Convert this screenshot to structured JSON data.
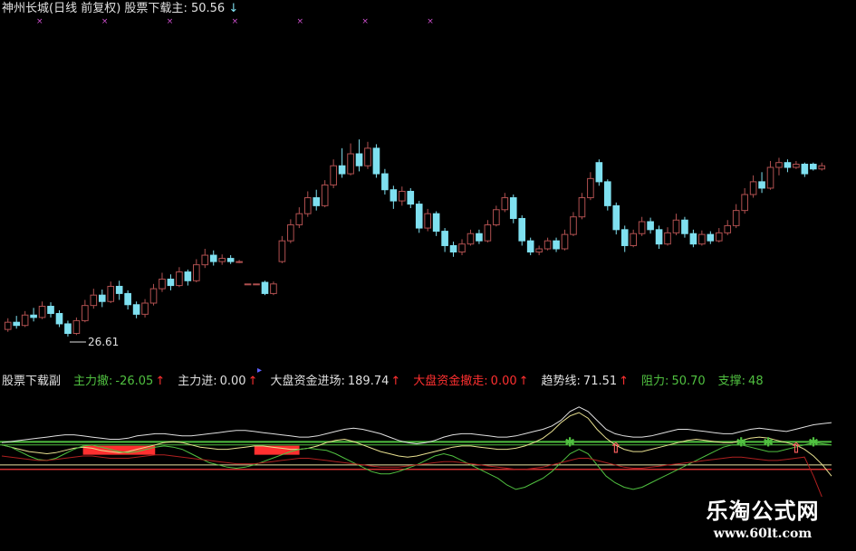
{
  "colors": {
    "up": "#b05050",
    "down": "#7fe0f0",
    "magenta": "#d050d0",
    "green": "#50c040",
    "red": "#ff3030",
    "white": "#e0e0e0",
    "yellow": "#e8e090"
  },
  "main_header": {
    "stock": "神州长城(日线 前复权)",
    "indicator_label": "股票下载主",
    "indicator_sep": ":",
    "indicator_value": "50.56",
    "arrow": "↓"
  },
  "sub_header": [
    {
      "label": "股票下载副",
      "value": "",
      "color": "#e0e0e0",
      "arrow": ""
    },
    {
      "label": "主力撤:",
      "value": "-26.05",
      "color": "#50c040",
      "arrow": "↑"
    },
    {
      "label": "主力进:",
      "value": "0.00",
      "color": "#e0e0e0",
      "arrow": "↑"
    },
    {
      "label": "大盘资金进场:",
      "value": "189.74",
      "color": "#e0e0e0",
      "arrow": "↑"
    },
    {
      "label": "大盘资金撤走:",
      "value": "0.00",
      "color": "#ff3030",
      "arrow": "↑"
    },
    {
      "label": "趋势线:",
      "value": "71.51",
      "color": "#e0e0e0",
      "arrow": "↑"
    },
    {
      "label": "阻力:",
      "value": "50.70",
      "color": "#50c040",
      "arrow": ""
    },
    {
      "label": "支撑:",
      "value": "48",
      "color": "#50c040",
      "arrow": ""
    }
  ],
  "chart_data": [
    {
      "type": "candlestick",
      "title": "神州长城(日线 前复权)",
      "annotations": [
        {
          "text": "26.61",
          "marks": "low"
        }
      ],
      "ylim": [
        24,
        58
      ],
      "candles": [
        {
          "o": 27.5,
          "c": 28.4,
          "h": 28.9,
          "l": 27.2
        },
        {
          "o": 28.4,
          "c": 28.0,
          "h": 29.2,
          "l": 27.6
        },
        {
          "o": 28.0,
          "c": 29.3,
          "h": 29.8,
          "l": 27.8
        },
        {
          "o": 29.3,
          "c": 29.0,
          "h": 30.2,
          "l": 28.5
        },
        {
          "o": 29.0,
          "c": 30.4,
          "h": 31.0,
          "l": 28.8
        },
        {
          "o": 30.4,
          "c": 29.5,
          "h": 30.9,
          "l": 29.0
        },
        {
          "o": 29.5,
          "c": 28.2,
          "h": 29.9,
          "l": 27.8
        },
        {
          "o": 28.2,
          "c": 27.0,
          "h": 28.6,
          "l": 26.61
        },
        {
          "o": 27.0,
          "c": 28.6,
          "h": 29.0,
          "l": 26.8
        },
        {
          "o": 28.6,
          "c": 30.5,
          "h": 31.2,
          "l": 28.4
        },
        {
          "o": 30.5,
          "c": 31.8,
          "h": 32.6,
          "l": 30.1
        },
        {
          "o": 31.8,
          "c": 31.0,
          "h": 32.5,
          "l": 30.3
        },
        {
          "o": 31.0,
          "c": 32.9,
          "h": 33.5,
          "l": 30.8
        },
        {
          "o": 32.9,
          "c": 32.0,
          "h": 33.6,
          "l": 31.2
        },
        {
          "o": 32.0,
          "c": 30.6,
          "h": 32.4,
          "l": 30.0
        },
        {
          "o": 30.6,
          "c": 29.4,
          "h": 31.0,
          "l": 28.9
        },
        {
          "o": 29.4,
          "c": 30.8,
          "h": 31.3,
          "l": 29.0
        },
        {
          "o": 30.8,
          "c": 32.6,
          "h": 33.2,
          "l": 30.5
        },
        {
          "o": 32.6,
          "c": 33.8,
          "h": 34.6,
          "l": 32.2
        },
        {
          "o": 33.8,
          "c": 33.0,
          "h": 34.4,
          "l": 32.4
        },
        {
          "o": 33.0,
          "c": 34.7,
          "h": 35.3,
          "l": 32.8
        },
        {
          "o": 34.7,
          "c": 33.6,
          "h": 35.0,
          "l": 33.0
        },
        {
          "o": 33.6,
          "c": 35.6,
          "h": 36.3,
          "l": 33.4
        },
        {
          "o": 35.6,
          "c": 36.8,
          "h": 37.6,
          "l": 35.2
        },
        {
          "o": 36.8,
          "c": 36.0,
          "h": 37.4,
          "l": 35.5
        },
        {
          "o": 36.0,
          "c": 36.4,
          "h": 36.9,
          "l": 35.6
        },
        {
          "o": 36.4,
          "c": 36.0,
          "h": 36.8,
          "l": 35.7
        },
        {
          "o": 36.0,
          "c": 36.0,
          "h": 36.2,
          "l": 35.8
        },
        {
          "o": 33.2,
          "c": 33.2,
          "h": 33.2,
          "l": 33.2
        },
        {
          "o": 33.2,
          "c": 33.2,
          "h": 33.2,
          "l": 33.2
        },
        {
          "o": 33.4,
          "c": 32.0,
          "h": 33.6,
          "l": 31.8
        },
        {
          "o": 32.0,
          "c": 33.2,
          "h": 33.5,
          "l": 31.8
        },
        {
          "o": 36.0,
          "c": 38.6,
          "h": 39.2,
          "l": 35.8
        },
        {
          "o": 38.6,
          "c": 40.6,
          "h": 41.3,
          "l": 38.3
        },
        {
          "o": 40.6,
          "c": 42.0,
          "h": 42.8,
          "l": 40.2
        },
        {
          "o": 42.0,
          "c": 44.0,
          "h": 44.8,
          "l": 41.6
        },
        {
          "o": 44.0,
          "c": 43.0,
          "h": 45.0,
          "l": 42.4
        },
        {
          "o": 43.0,
          "c": 45.6,
          "h": 46.2,
          "l": 42.8
        },
        {
          "o": 45.6,
          "c": 48.0,
          "h": 48.8,
          "l": 45.2
        },
        {
          "o": 48.0,
          "c": 47.0,
          "h": 50.2,
          "l": 46.5
        },
        {
          "o": 47.0,
          "c": 49.5,
          "h": 50.8,
          "l": 46.8
        },
        {
          "o": 49.5,
          "c": 48.0,
          "h": 51.3,
          "l": 47.3
        },
        {
          "o": 48.0,
          "c": 50.2,
          "h": 51.0,
          "l": 47.6
        },
        {
          "o": 50.2,
          "c": 47.0,
          "h": 50.7,
          "l": 46.5
        },
        {
          "o": 47.0,
          "c": 45.0,
          "h": 47.6,
          "l": 44.4
        },
        {
          "o": 45.0,
          "c": 43.6,
          "h": 45.5,
          "l": 42.6
        },
        {
          "o": 43.6,
          "c": 44.8,
          "h": 45.4,
          "l": 43.0
        },
        {
          "o": 44.8,
          "c": 43.2,
          "h": 45.2,
          "l": 42.7
        },
        {
          "o": 43.2,
          "c": 40.2,
          "h": 43.6,
          "l": 39.6
        },
        {
          "o": 40.2,
          "c": 42.0,
          "h": 42.6,
          "l": 39.8
        },
        {
          "o": 42.0,
          "c": 39.8,
          "h": 42.3,
          "l": 39.2
        },
        {
          "o": 39.8,
          "c": 38.0,
          "h": 40.2,
          "l": 37.2
        },
        {
          "o": 38.0,
          "c": 37.2,
          "h": 38.5,
          "l": 36.6
        },
        {
          "o": 37.2,
          "c": 38.2,
          "h": 38.8,
          "l": 36.8
        },
        {
          "o": 38.2,
          "c": 39.5,
          "h": 40.0,
          "l": 38.0
        },
        {
          "o": 39.5,
          "c": 38.6,
          "h": 40.0,
          "l": 38.2
        },
        {
          "o": 38.6,
          "c": 40.6,
          "h": 41.2,
          "l": 38.4
        },
        {
          "o": 40.6,
          "c": 42.5,
          "h": 43.0,
          "l": 40.4
        },
        {
          "o": 42.5,
          "c": 44.0,
          "h": 44.6,
          "l": 42.2
        },
        {
          "o": 44.0,
          "c": 41.4,
          "h": 44.4,
          "l": 40.8
        },
        {
          "o": 41.4,
          "c": 38.6,
          "h": 41.8,
          "l": 38.0
        },
        {
          "o": 38.6,
          "c": 37.2,
          "h": 39.0,
          "l": 36.8
        },
        {
          "o": 37.2,
          "c": 37.6,
          "h": 38.0,
          "l": 36.8
        },
        {
          "o": 37.6,
          "c": 38.6,
          "h": 39.0,
          "l": 37.4
        },
        {
          "o": 38.6,
          "c": 37.6,
          "h": 39.0,
          "l": 37.2
        },
        {
          "o": 37.6,
          "c": 39.4,
          "h": 40.0,
          "l": 37.4
        },
        {
          "o": 39.4,
          "c": 41.6,
          "h": 42.2,
          "l": 39.2
        },
        {
          "o": 41.6,
          "c": 44.0,
          "h": 44.6,
          "l": 41.3
        },
        {
          "o": 44.0,
          "c": 46.4,
          "h": 47.2,
          "l": 43.7
        },
        {
          "o": 48.4,
          "c": 46.0,
          "h": 48.8,
          "l": 45.5
        },
        {
          "o": 46.0,
          "c": 43.0,
          "h": 46.3,
          "l": 42.4
        },
        {
          "o": 43.0,
          "c": 40.0,
          "h": 43.4,
          "l": 39.4
        },
        {
          "o": 40.0,
          "c": 38.0,
          "h": 40.5,
          "l": 37.2
        },
        {
          "o": 38.0,
          "c": 39.5,
          "h": 40.0,
          "l": 37.8
        },
        {
          "o": 39.5,
          "c": 41.0,
          "h": 41.6,
          "l": 39.2
        },
        {
          "o": 41.0,
          "c": 40.0,
          "h": 41.5,
          "l": 39.5
        },
        {
          "o": 40.0,
          "c": 38.2,
          "h": 40.5,
          "l": 37.6
        },
        {
          "o": 38.2,
          "c": 39.6,
          "h": 40.3,
          "l": 38.0
        },
        {
          "o": 39.6,
          "c": 41.2,
          "h": 42.0,
          "l": 39.3
        },
        {
          "o": 41.2,
          "c": 39.5,
          "h": 41.6,
          "l": 39.0
        },
        {
          "o": 39.5,
          "c": 38.2,
          "h": 40.0,
          "l": 37.8
        },
        {
          "o": 38.2,
          "c": 39.4,
          "h": 39.9,
          "l": 38.0
        },
        {
          "o": 39.4,
          "c": 38.6,
          "h": 39.8,
          "l": 38.2
        },
        {
          "o": 38.6,
          "c": 39.6,
          "h": 40.2,
          "l": 38.4
        },
        {
          "o": 39.6,
          "c": 40.5,
          "h": 41.2,
          "l": 39.3
        },
        {
          "o": 40.5,
          "c": 42.4,
          "h": 43.2,
          "l": 40.2
        },
        {
          "o": 42.4,
          "c": 44.4,
          "h": 45.2,
          "l": 42.0
        },
        {
          "o": 44.4,
          "c": 46.0,
          "h": 46.8,
          "l": 44.0
        },
        {
          "o": 46.0,
          "c": 45.2,
          "h": 47.2,
          "l": 44.6
        },
        {
          "o": 45.2,
          "c": 47.8,
          "h": 48.6,
          "l": 45.0
        },
        {
          "o": 47.8,
          "c": 48.4,
          "h": 49.0,
          "l": 46.8
        },
        {
          "o": 48.4,
          "c": 47.8,
          "h": 48.8,
          "l": 47.2
        },
        {
          "o": 47.8,
          "c": 48.2,
          "h": 48.6,
          "l": 47.6
        },
        {
          "o": 48.2,
          "c": 47.0,
          "h": 48.4,
          "l": 46.6
        },
        {
          "o": 48.2,
          "c": 47.6,
          "h": 48.4,
          "l": 47.4
        },
        {
          "o": 47.6,
          "c": 48.0,
          "h": 48.4,
          "l": 47.4
        }
      ]
    },
    {
      "type": "line",
      "title": "股票下载副",
      "levels": [
        {
          "name": "阻力",
          "value": 50.7
        },
        {
          "name": "支撑",
          "value": 48
        }
      ],
      "ylim": [
        -40,
        90
      ],
      "series": [
        {
          "role": "white",
          "values": [
            50,
            51,
            52,
            53,
            54,
            55,
            56,
            57,
            57,
            56,
            55,
            54,
            53,
            53,
            54,
            56,
            57,
            58,
            58,
            57,
            56,
            56,
            57,
            58,
            59,
            60,
            61,
            61,
            60,
            59,
            58,
            57,
            56,
            55,
            55,
            56,
            58,
            60,
            62,
            63,
            62,
            60,
            58,
            55,
            52,
            50,
            49,
            50,
            52,
            55,
            57,
            58,
            58,
            57,
            56,
            55,
            55,
            56,
            58,
            60,
            62,
            65,
            70,
            78,
            82,
            78,
            70,
            62,
            58,
            56,
            55,
            55,
            56,
            58,
            60,
            62,
            62,
            61,
            60,
            59,
            58,
            58,
            60,
            62,
            63,
            62,
            61,
            60,
            62,
            64,
            66,
            67,
            68
          ]
        },
        {
          "role": "yellow",
          "values": [
            48,
            46,
            44,
            42,
            41,
            40,
            41,
            43,
            45,
            46,
            45,
            43,
            42,
            41,
            42,
            44,
            46,
            48,
            50,
            51,
            50,
            48,
            46,
            45,
            44,
            44,
            45,
            46,
            47,
            47,
            46,
            45,
            44,
            44,
            45,
            47,
            50,
            52,
            53,
            51,
            48,
            45,
            42,
            40,
            38,
            37,
            38,
            40,
            42,
            44,
            46,
            47,
            47,
            46,
            45,
            44,
            44,
            45,
            47,
            50,
            54,
            60,
            68,
            74,
            77,
            72,
            62,
            54,
            48,
            44,
            42,
            42,
            44,
            46,
            48,
            50,
            52,
            53,
            52,
            51,
            50,
            50,
            52,
            54,
            55,
            54,
            52,
            50,
            48,
            44,
            38,
            30,
            20
          ]
        },
        {
          "role": "green",
          "values": [
            48,
            46,
            42,
            38,
            35,
            34,
            36,
            40,
            44,
            47,
            48,
            46,
            44,
            42,
            41,
            42,
            44,
            46,
            47,
            46,
            44,
            40,
            36,
            32,
            30,
            28,
            27,
            28,
            30,
            33,
            36,
            39,
            42,
            44,
            45,
            44,
            43,
            40,
            36,
            32,
            28,
            24,
            22,
            22,
            24,
            27,
            30,
            34,
            38,
            40,
            38,
            34,
            30,
            26,
            22,
            18,
            12,
            8,
            10,
            14,
            18,
            24,
            32,
            40,
            44,
            40,
            30,
            20,
            14,
            10,
            8,
            10,
            14,
            18,
            22,
            26,
            30,
            34,
            38,
            42,
            46,
            48,
            48,
            46,
            44,
            42,
            42,
            44,
            46,
            48,
            50,
            49,
            48
          ]
        },
        {
          "role": "darkred",
          "values": [
            38,
            37,
            36,
            35,
            34,
            34,
            35,
            36,
            37,
            38,
            38,
            37,
            36,
            36,
            36,
            37,
            38,
            39,
            39,
            38,
            37,
            36,
            35,
            34,
            33,
            32,
            31,
            31,
            31,
            32,
            33,
            34,
            35,
            36,
            36,
            35,
            34,
            33,
            32,
            31,
            30,
            29,
            28,
            28,
            28,
            29,
            30,
            31,
            32,
            33,
            33,
            32,
            31,
            30,
            29,
            28,
            27,
            26,
            26,
            27,
            28,
            30,
            32,
            34,
            36,
            36,
            34,
            32,
            30,
            28,
            27,
            27,
            28,
            29,
            30,
            31,
            32,
            33,
            34,
            35,
            36,
            37,
            37,
            36,
            35,
            34,
            34,
            35,
            36,
            37,
            20,
            0,
            -30
          ]
        }
      ],
      "bars": [
        {
          "range": [
            9,
            17
          ],
          "value": 44
        },
        {
          "range": [
            28,
            33
          ],
          "value": 44
        }
      ],
      "signals": [
        {
          "type": "star",
          "index": 63
        },
        {
          "type": "up-arrow",
          "index": 68
        },
        {
          "type": "star",
          "index": 82
        },
        {
          "type": "star",
          "index": 85
        },
        {
          "type": "up-arrow",
          "index": 88
        },
        {
          "type": "star",
          "index": 90
        }
      ]
    }
  ],
  "watermark": {
    "title": "乐淘公式网",
    "url": "www.60lt.com"
  }
}
